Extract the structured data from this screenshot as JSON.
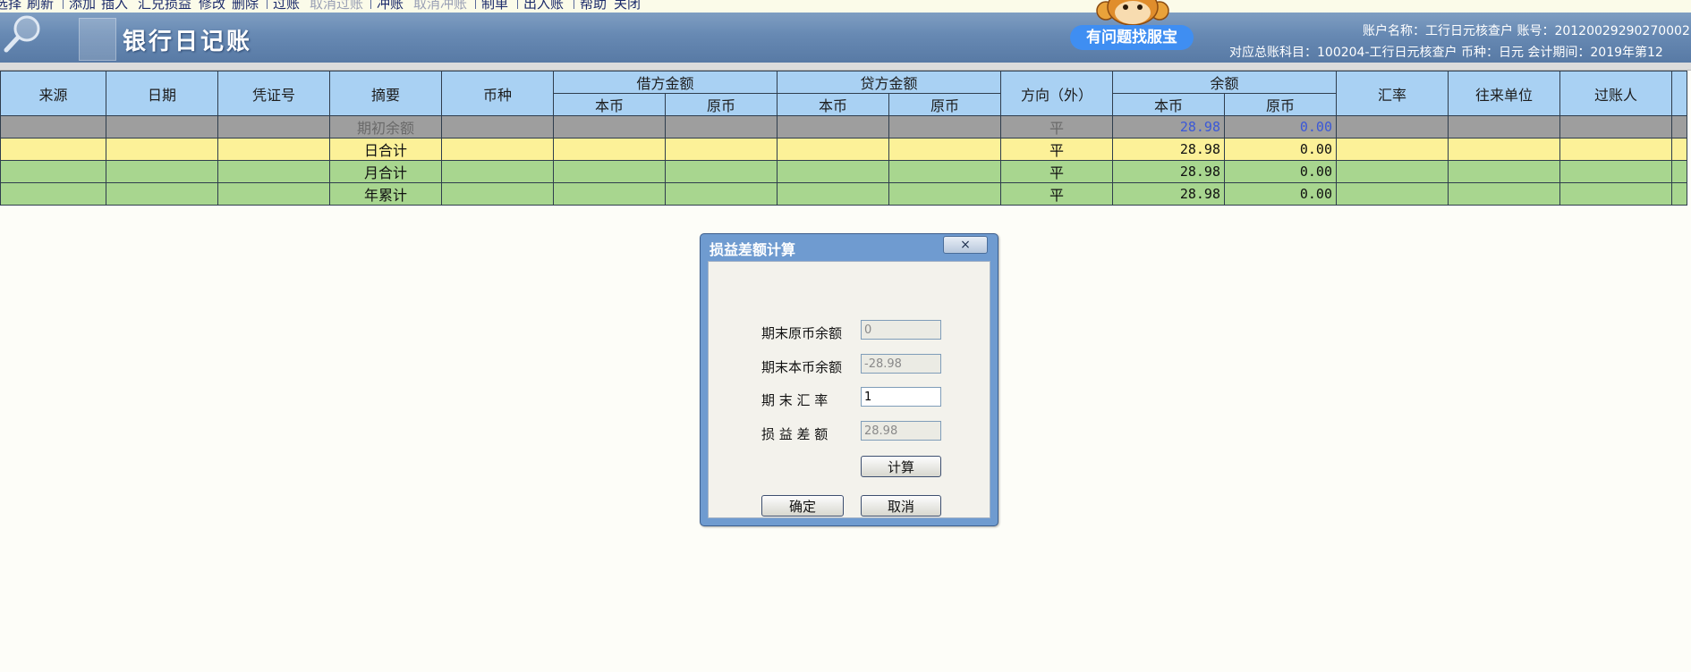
{
  "toolbar": {
    "items": [
      {
        "label": "选择",
        "dim": false
      },
      {
        "label": "刷新",
        "dim": false
      },
      {
        "label": "添加",
        "dim": false
      },
      {
        "label": "插入",
        "dim": false
      },
      {
        "label": "汇兑损益",
        "dim": false
      },
      {
        "label": "修改",
        "dim": false
      },
      {
        "label": "删除",
        "dim": false
      },
      {
        "label": "过账",
        "dim": false
      },
      {
        "label": "取消过账",
        "dim": true
      },
      {
        "label": "冲账",
        "dim": false
      },
      {
        "label": "取消冲账",
        "dim": true
      },
      {
        "label": "制单",
        "dim": false
      },
      {
        "label": "出入账",
        "dim": false
      },
      {
        "label": "帮助",
        "dim": false
      },
      {
        "label": "关闭",
        "dim": false
      }
    ]
  },
  "banner": {
    "title": "银行日记账",
    "help_button": "有问题找服宝",
    "info_line1": "账户名称：工行日元核查户   账号：20120029290270002",
    "info_line2": "对应总账科目：100204-工行日元核查户   币种：日元   会计期间：2019年第12"
  },
  "table": {
    "headers": {
      "source": "来源",
      "date": "日期",
      "voucher_no": "凭证号",
      "summary": "摘要",
      "currency": "币种",
      "debit": "借方金额",
      "credit": "贷方金额",
      "direction": "方向（外）",
      "balance": "余额",
      "rate": "汇率",
      "partner": "往来单位",
      "poster": "过账人",
      "local": "本币",
      "original": "原币"
    },
    "rows": [
      {
        "type": "open",
        "summary": "期初余额",
        "direction": "平",
        "bal_local": "28.98",
        "bal_orig": "0.00"
      },
      {
        "type": "day",
        "summary": "日合计",
        "direction": "平",
        "bal_local": "28.98",
        "bal_orig": "0.00"
      },
      {
        "type": "month",
        "summary": "月合计",
        "direction": "平",
        "bal_local": "28.98",
        "bal_orig": "0.00"
      },
      {
        "type": "year",
        "summary": "年累计",
        "direction": "平",
        "bal_local": "28.98",
        "bal_orig": "0.00"
      }
    ]
  },
  "dialog": {
    "title": "损益差额计算",
    "close_glyph": "×",
    "labels": {
      "end_orig_balance": "期末原币余额",
      "end_local_balance": "期末本币余额",
      "end_rate": "期 末 汇 率",
      "pl_diff": "损 益 差 额"
    },
    "values": {
      "end_orig_balance": "0",
      "end_local_balance": "-28.98",
      "end_rate": "1",
      "pl_diff": "28.98"
    },
    "buttons": {
      "calc": "计算",
      "ok": "确定",
      "cancel": "取消"
    }
  },
  "colors": {
    "header_bg": "#a9d1f3",
    "row_open": "#9e9e9e",
    "row_day": "#fcf198",
    "row_total": "#a8d68f",
    "amount_text": "#1b36c7",
    "banner": "#6789b3",
    "help_button": "#3f8ef2"
  }
}
